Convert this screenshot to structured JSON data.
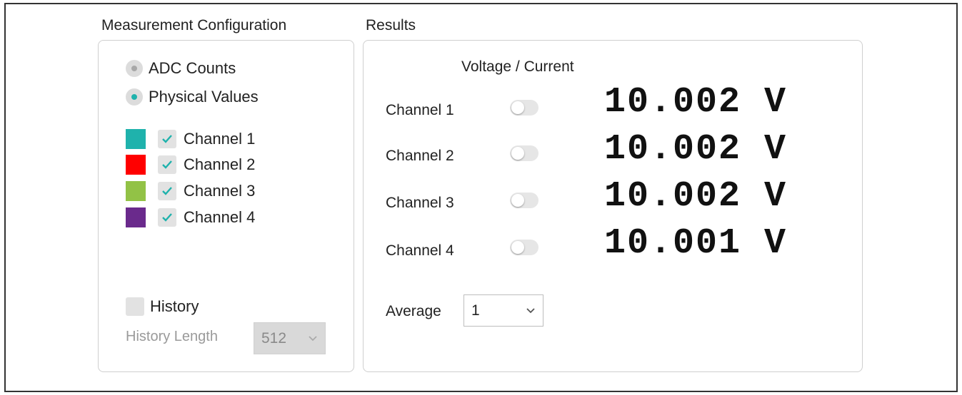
{
  "config": {
    "title": "Measurement Configuration",
    "radios": [
      {
        "label": "ADC Counts",
        "selected": false
      },
      {
        "label": "Physical Values",
        "selected": true
      }
    ],
    "channels": [
      {
        "label": "Channel 1",
        "color": "#1fb2ac",
        "checked": true
      },
      {
        "label": "Channel 2",
        "color": "#ff0000",
        "checked": true
      },
      {
        "label": "Channel 3",
        "color": "#92c246",
        "checked": true
      },
      {
        "label": "Channel 4",
        "color": "#6a2a8c",
        "checked": true
      }
    ],
    "history_label": "History",
    "history_checked": false,
    "history_length_label": "History Length",
    "history_length_value": "512"
  },
  "results": {
    "title": "Results",
    "column_header": "Voltage / Current",
    "rows": [
      {
        "label": "Channel 1",
        "reading": "10.002 V",
        "toggle_on": false
      },
      {
        "label": "Channel 2",
        "reading": "10.002 V",
        "toggle_on": false
      },
      {
        "label": "Channel 3",
        "reading": "10.002 V",
        "toggle_on": false
      },
      {
        "label": "Channel 4",
        "reading": "10.001 V",
        "toggle_on": false
      }
    ],
    "average_label": "Average",
    "average_value": "1"
  },
  "colors": {
    "accent": "#1fb2ac"
  }
}
